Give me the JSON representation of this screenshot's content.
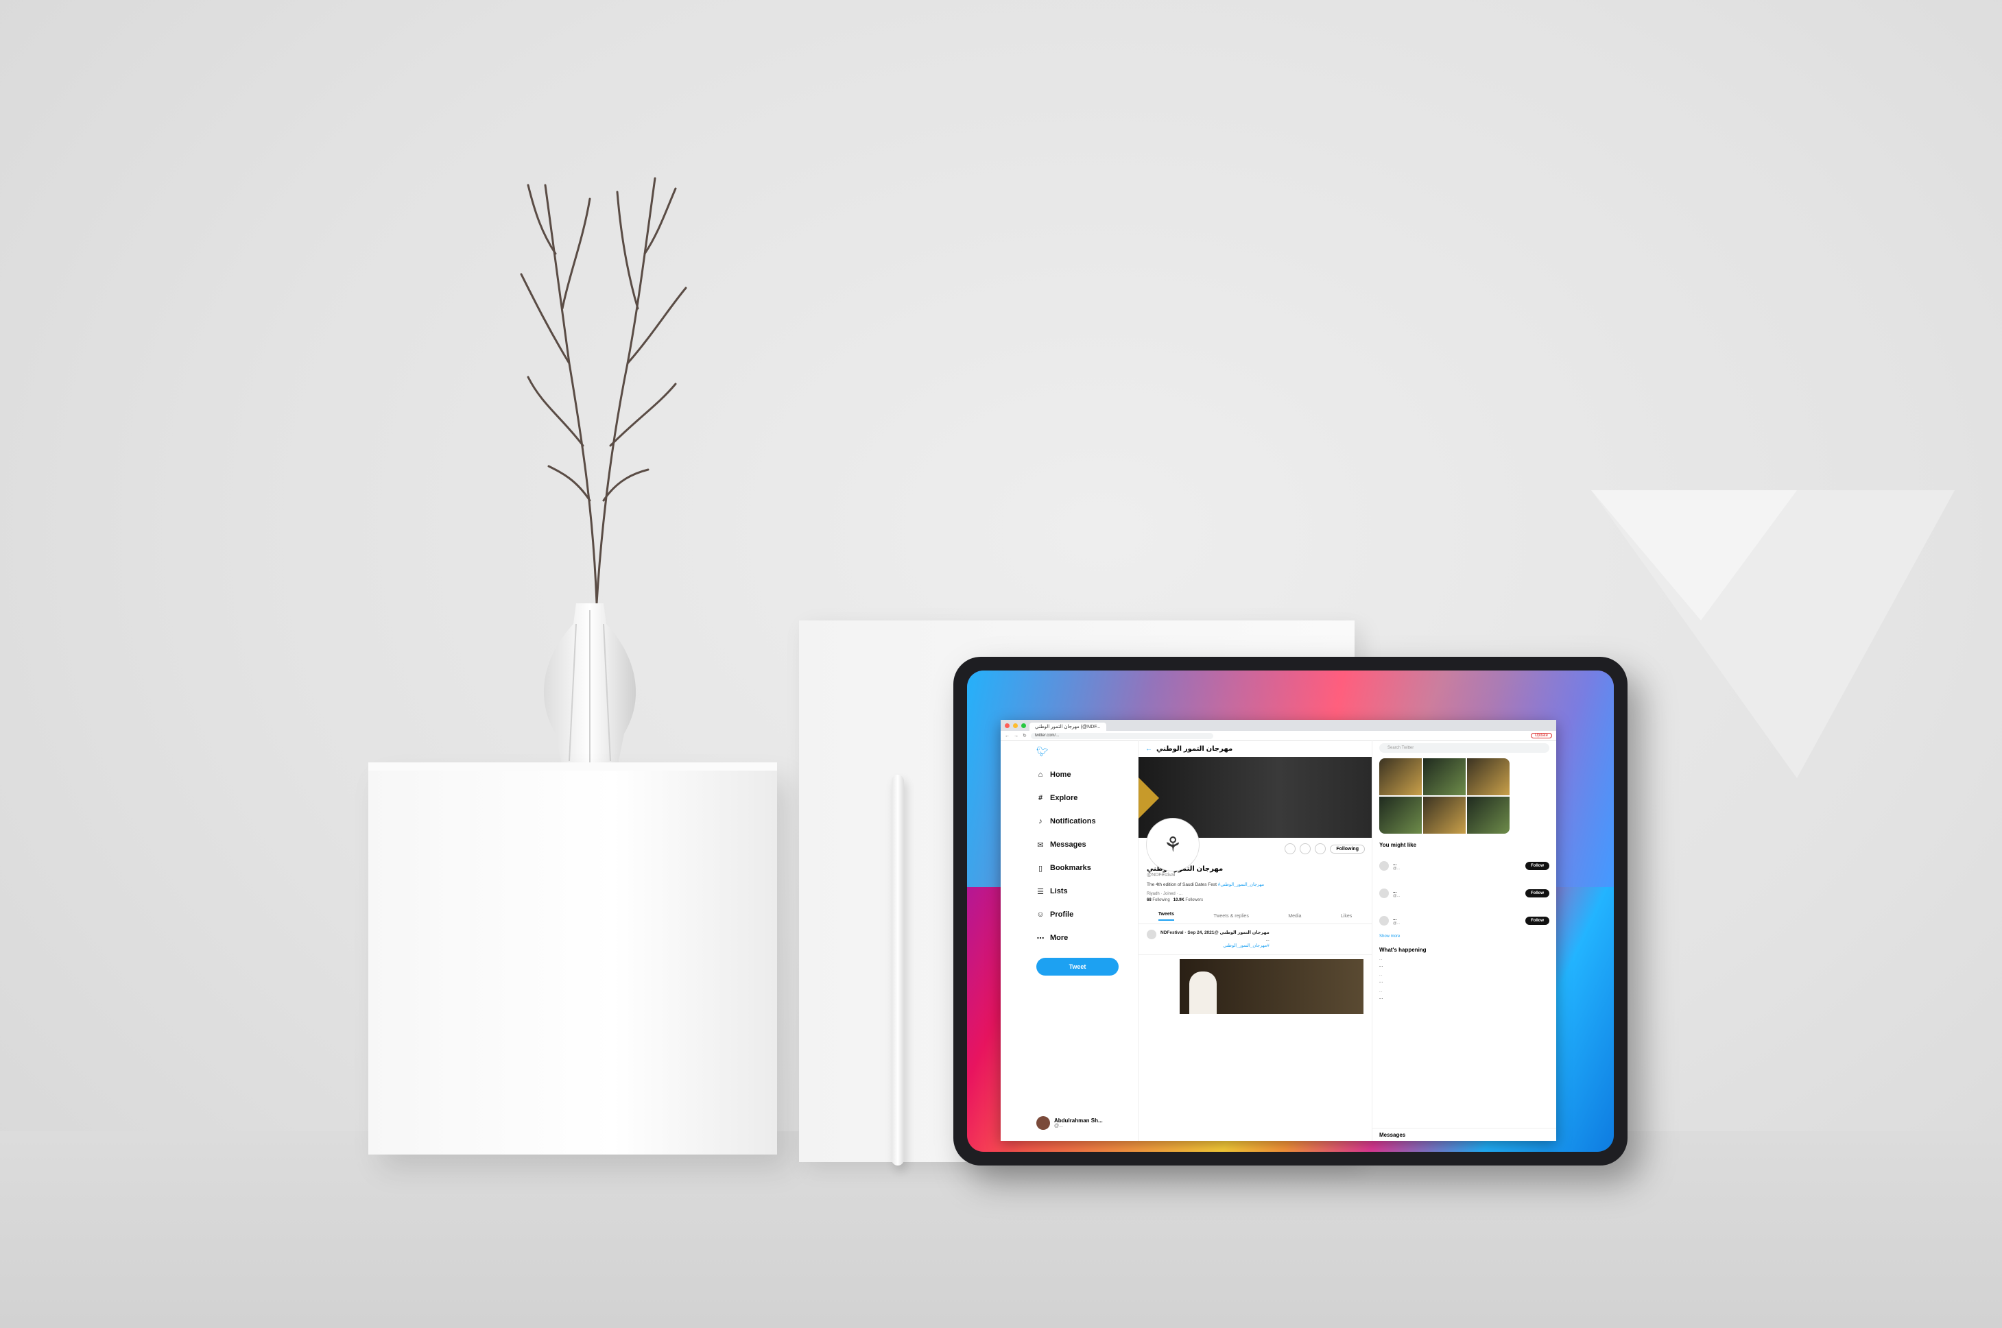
{
  "browser": {
    "tab_title": "مهرجان التمور الوطني (@NDF...",
    "url": "twitter.com/...",
    "update_label": "Update"
  },
  "nav": {
    "items": [
      {
        "icon": "home-icon",
        "glyph": "⌂",
        "label": "Home"
      },
      {
        "icon": "explore-icon",
        "glyph": "#",
        "label": "Explore"
      },
      {
        "icon": "bell-icon",
        "glyph": "♪",
        "label": "Notifications"
      },
      {
        "icon": "mail-icon",
        "glyph": "✉",
        "label": "Messages"
      },
      {
        "icon": "bookmark-icon",
        "glyph": "▯",
        "label": "Bookmarks"
      },
      {
        "icon": "list-icon",
        "glyph": "☰",
        "label": "Lists"
      },
      {
        "icon": "profile-icon",
        "glyph": "☺",
        "label": "Profile"
      },
      {
        "icon": "more-icon",
        "glyph": "⋯",
        "label": "More"
      }
    ],
    "tweet_button": "Tweet",
    "account_name": "Abdulrahman Sh...",
    "account_handle": "@..."
  },
  "profile": {
    "header_name": "مهرجان التمور الوطني",
    "header_sub": "",
    "name": "مهرجان التمور الوطني",
    "handle": "@NDFestival",
    "bio_line1": "The 4th edition of Saudi Dates Fest",
    "bio_link": "#مهرجان_التمور_الوطني",
    "bio_line2": "",
    "meta": "Riyadh · Joined · ...",
    "following_count": "68",
    "following_label": "Following",
    "followers_count": "10.9K",
    "followers_label": "Followers",
    "following_button": "Following",
    "tabs": [
      "Tweets",
      "Tweets & replies",
      "Media",
      "Likes"
    ]
  },
  "tweet": {
    "head": "مهرجان التمور الوطني @NDFestival · Sep 24, 2021",
    "body": "...",
    "link": "#مهرجان_التمور_الوطني",
    "image_caption": ""
  },
  "right": {
    "search_placeholder": "Search Twitter",
    "suggest_title": "You might like",
    "suggestions": [
      {
        "name": "...",
        "handle": "@...",
        "button": "Follow"
      },
      {
        "name": "...",
        "handle": "@...",
        "button": "Follow"
      },
      {
        "name": "...",
        "handle": "@...",
        "button": "Follow"
      }
    ],
    "show_more": "Show more",
    "happening_title": "What's happening",
    "trends": [
      {
        "meta": "...",
        "text": "..."
      },
      {
        "meta": "...",
        "text": "..."
      },
      {
        "meta": "...",
        "text": "..."
      }
    ],
    "messages_label": "Messages"
  }
}
